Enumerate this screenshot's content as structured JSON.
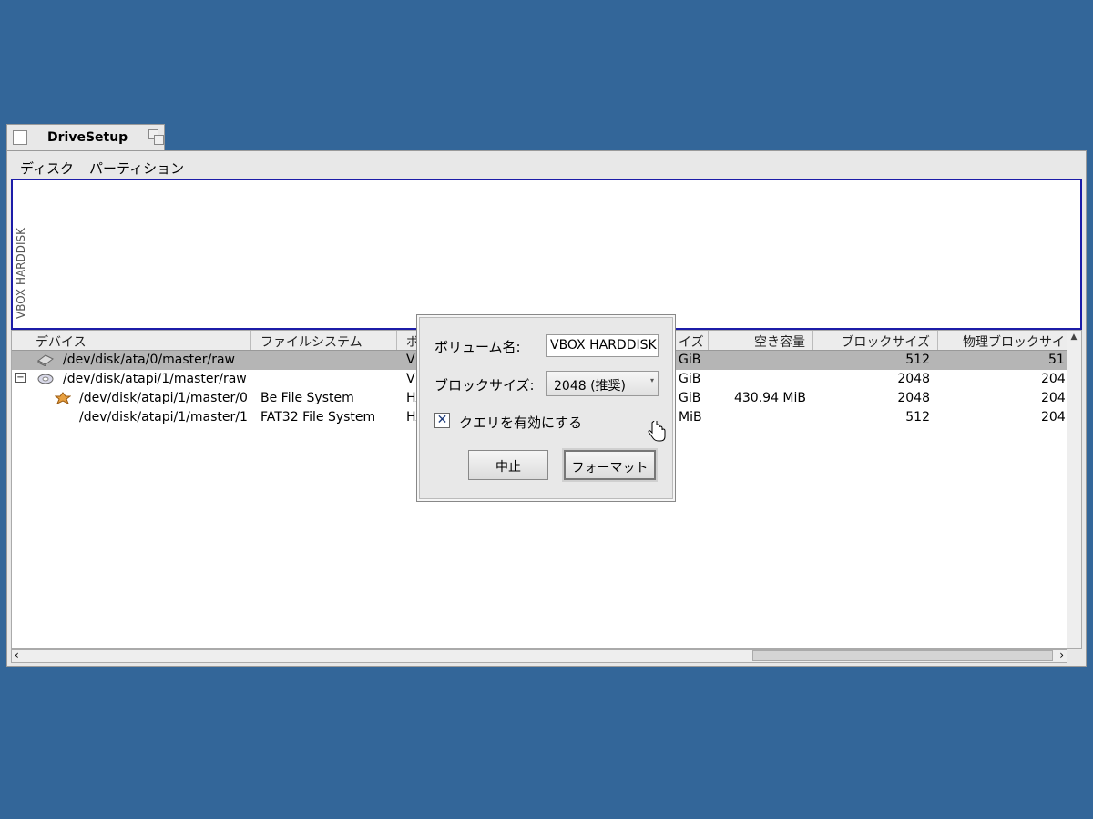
{
  "window": {
    "title": "DriveSetup"
  },
  "menubar": {
    "items": [
      "ディスク",
      "パーティション"
    ]
  },
  "diskmap": {
    "label": "VBOX HARDDISK"
  },
  "table": {
    "columns": [
      "デバイス",
      "ファイルシステム",
      "ボ",
      "イズ",
      "空き容量",
      "ブロックサイズ",
      "物理ブロックサイ"
    ],
    "rows": [
      {
        "device": "/dev/disk/ata/0/master/raw",
        "filesystem": "",
        "volume": "VE",
        "size": "GiB",
        "free": "",
        "block": "512",
        "phys": "51"
      },
      {
        "device": "/dev/disk/atapi/1/master/raw",
        "filesystem": "",
        "volume": "VE",
        "size": "GiB",
        "free": "",
        "block": "2048",
        "phys": "204"
      },
      {
        "device": "/dev/disk/atapi/1/master/0",
        "filesystem": "Be File System",
        "volume": "HA",
        "size": "GiB",
        "free": "430.94 MiB",
        "block": "2048",
        "phys": "204"
      },
      {
        "device": "/dev/disk/atapi/1/master/1",
        "filesystem": "FAT32 File System",
        "volume": "HA",
        "size": "MiB",
        "free": "",
        "block": "512",
        "phys": "204"
      }
    ],
    "expander": "⊟"
  },
  "dialog": {
    "volume_label": "ボリューム名:",
    "volume_value": "VBOX HARDDISK",
    "block_label": "ブロックサイズ:",
    "block_value": "2048 (推奨)",
    "query_label": "クエリを有効にする",
    "query_checked": true,
    "cancel": "中止",
    "format": "フォーマット"
  },
  "colors": {
    "desktop": "#336699",
    "selection": "#b5b5b5",
    "focus_border": "#1c1ca8"
  }
}
